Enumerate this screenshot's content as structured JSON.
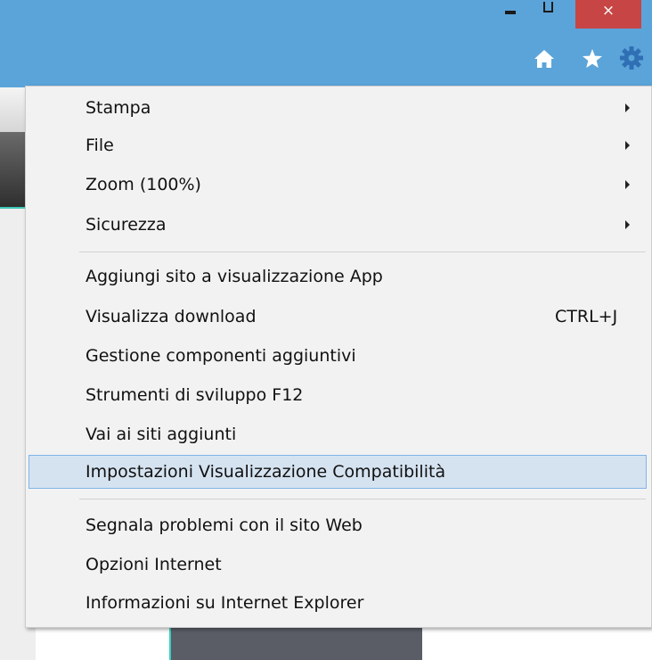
{
  "window": {
    "minimize_icon": "minimize-icon",
    "maximize_icon": "restore-icon",
    "close_label": "×"
  },
  "toolbar": {
    "home_icon": "home-icon",
    "favorites_icon": "star-icon",
    "tools_icon": "gear-icon"
  },
  "menu": {
    "group1": [
      {
        "label": "Stampa",
        "submenu": true
      },
      {
        "label": "File",
        "submenu": true
      },
      {
        "label": "Zoom (100%)",
        "submenu": true
      },
      {
        "label": "Sicurezza",
        "submenu": true
      }
    ],
    "group2": [
      {
        "label": "Aggiungi sito a visualizzazione App"
      },
      {
        "label": "Visualizza download",
        "shortcut": "CTRL+J"
      },
      {
        "label": "Gestione componenti aggiuntivi"
      },
      {
        "label": "Strumenti di sviluppo F12"
      },
      {
        "label": "Vai ai siti aggiunti"
      },
      {
        "label": "Impostazioni Visualizzazione Compatibilità",
        "highlighted": true
      }
    ],
    "group3": [
      {
        "label": "Segnala problemi con il sito Web"
      },
      {
        "label": "Opzioni Internet"
      },
      {
        "label": "Informazioni su Internet Explorer"
      }
    ]
  },
  "colors": {
    "chrome": "#5ba4d9",
    "close": "#c74545",
    "menu_bg": "#f2f2f2",
    "highlight": "#d5e3f1",
    "highlight_border": "#7eb4ea"
  }
}
